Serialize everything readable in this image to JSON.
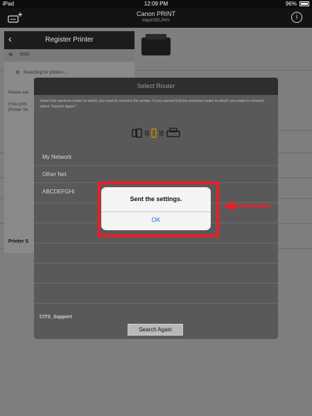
{
  "status_bar": {
    "device": "iPad",
    "time": "12:09 PM",
    "battery": "96%"
  },
  "app": {
    "title": "Canon PRINT",
    "subtitle": "Inkjet/SELPHY"
  },
  "register_panel": {
    "title": "Register Printer",
    "ssid_label": "SSID:",
    "searching": "Searching for printers...",
    "text1": "Please wai",
    "text2": "If the print",
    "text3": "[Printer Se",
    "printer_setup": "Printer S"
  },
  "select_router": {
    "title": "Select Router",
    "description": "Select the wireless router to which you want to connect the printer. If you cannot find the wireless router to which you want to connect, select \"Search Again\".",
    "networks": [
      "My Network",
      "Other Net",
      "ABCDEFGHI",
      "",
      "",
      "",
      "",
      ""
    ],
    "support_label": "CITS_Support",
    "search_again": "Search Again"
  },
  "alert": {
    "message": "Sent the settings.",
    "ok_label": "OK"
  },
  "colors": {
    "highlight": "#ee1c25",
    "link_blue": "#1e74e6"
  }
}
